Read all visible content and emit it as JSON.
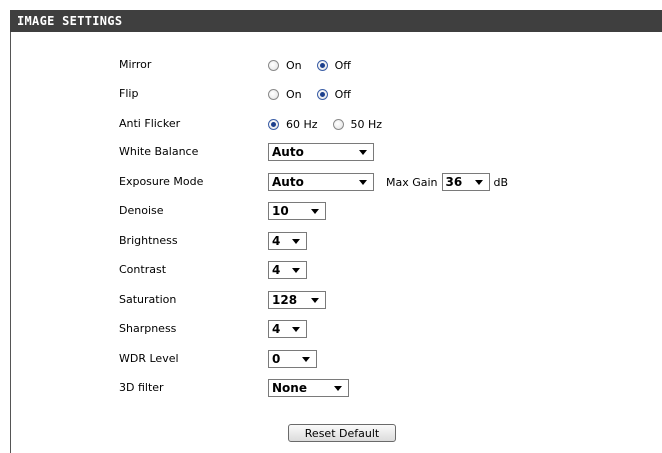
{
  "header": {
    "title": "IMAGE SETTINGS"
  },
  "rows": {
    "mirror": {
      "label": "Mirror",
      "options": [
        "On",
        "Off"
      ],
      "selected": "Off"
    },
    "flip": {
      "label": "Flip",
      "options": [
        "On",
        "Off"
      ],
      "selected": "Off"
    },
    "anti_flicker": {
      "label": "Anti Flicker",
      "options": [
        "60 Hz",
        "50 Hz"
      ],
      "selected": "60 Hz"
    },
    "white_balance": {
      "label": "White Balance",
      "value": "Auto"
    },
    "exposure_mode": {
      "label": "Exposure Mode",
      "value": "Auto",
      "max_gain_label": "Max Gain",
      "max_gain_value": "36",
      "max_gain_unit": "dB"
    },
    "denoise": {
      "label": "Denoise",
      "value": "10"
    },
    "brightness": {
      "label": "Brightness",
      "value": "4"
    },
    "contrast": {
      "label": "Contrast",
      "value": "4"
    },
    "saturation": {
      "label": "Saturation",
      "value": "128"
    },
    "sharpness": {
      "label": "Sharpness",
      "value": "4"
    },
    "wdr_level": {
      "label": "WDR Level",
      "value": "0"
    },
    "filter_3d": {
      "label": "3D filter",
      "value": "None"
    }
  },
  "reset_button": {
    "label": "Reset Default"
  }
}
